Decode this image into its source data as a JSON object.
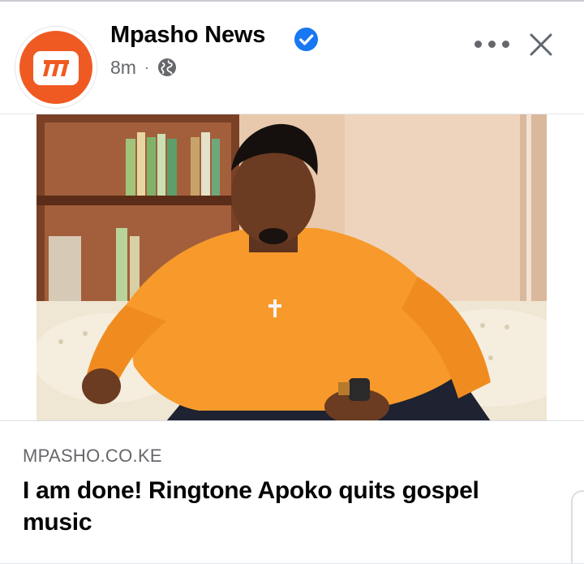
{
  "post": {
    "page_name": "Mpasho News",
    "timestamp": "8m",
    "separator": "·",
    "avatar_icon": "mpasho-logo-icon",
    "verified_icon": "verified-badge-icon",
    "audience_icon": "globe-icon",
    "more_icon": "more-options-icon",
    "close_icon": "close-icon"
  },
  "image": {
    "icon": "article-photo"
  },
  "link_preview": {
    "domain": "MPASHO.CO.KE",
    "title": "I am done! Ringtone Apoko quits gospel music"
  },
  "colors": {
    "brand": "#ef5a23",
    "verified": "#1877f2",
    "text_primary": "#050505",
    "text_secondary": "#65676b"
  }
}
